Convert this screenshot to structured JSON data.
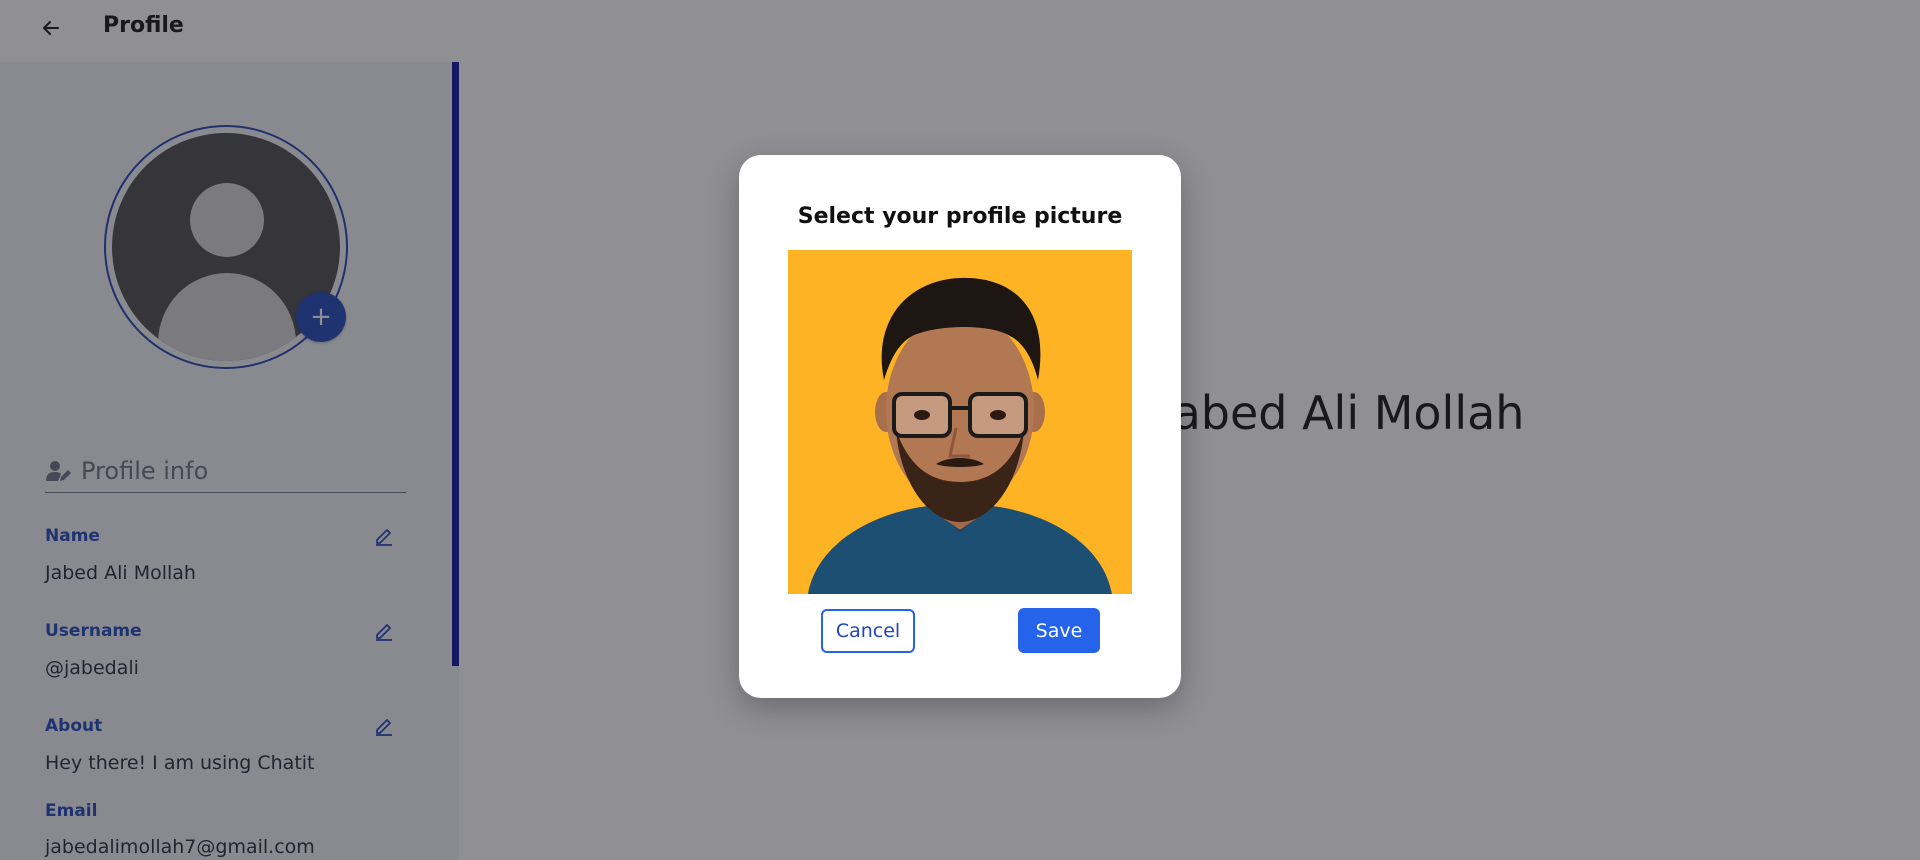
{
  "header": {
    "title": "Profile",
    "back_icon": "arrow-left-icon"
  },
  "avatar": {
    "add_icon_glyph": "+"
  },
  "profile_info": {
    "section_title": "Profile info",
    "fields": [
      {
        "label": "Name",
        "value": "Jabed Ali Mollah",
        "editable": true
      },
      {
        "label": "Username",
        "value": "@jabedali",
        "editable": true
      },
      {
        "label": "About",
        "value": "Hey there! I am using Chatit",
        "editable": true
      },
      {
        "label": "Email",
        "value": "jabedalimollah7@gmail.com",
        "editable": false
      }
    ]
  },
  "main": {
    "display_name": "Jabed Ali Mollah"
  },
  "modal": {
    "title": "Select your profile picture",
    "cancel_label": "Cancel",
    "save_label": "Save"
  },
  "colors": {
    "accent": "#2563eb",
    "accent_dark": "#2146b8",
    "photo_background": "#fdb324",
    "scrollbar": "#0b0f9a"
  }
}
